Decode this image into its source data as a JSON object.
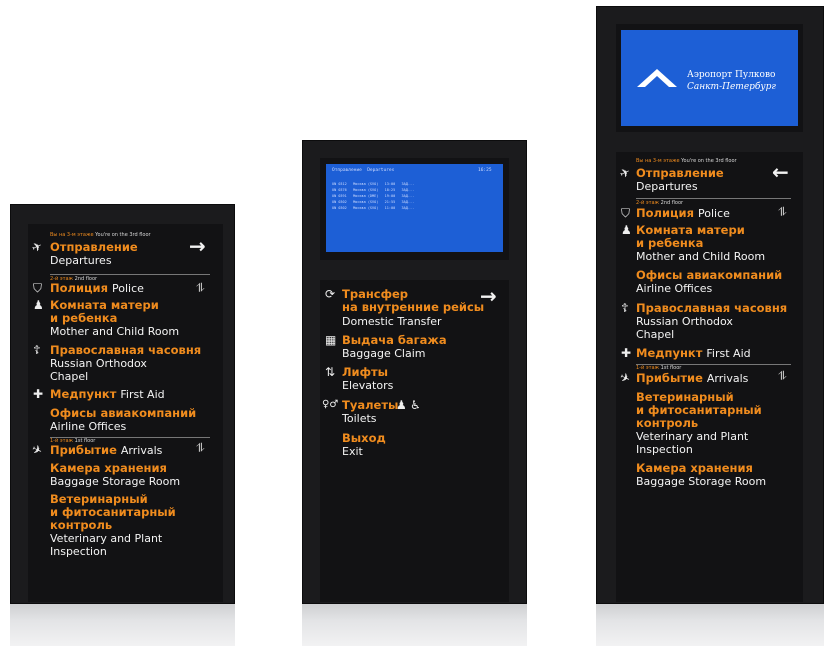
{
  "colors": {
    "totem": "#1b1b1d",
    "accent_orange": "#f08c1e",
    "screen_blue": "#1d5fd6",
    "text_white": "#f4f4f4"
  },
  "floor_labels": {
    "you_are_here_ru": "Вы на 3-м этаже",
    "you_are_here_en": "You're on the 3rd floor",
    "second_ru": "2-й этаж",
    "second_en": "2nd floor",
    "first_ru": "1-й этаж",
    "first_en": "1st floor"
  },
  "airport_logo": {
    "line1": "Аэропорт Пулково",
    "line2": "Санкт-Петербург",
    "icon": "pulkovo-logo-icon"
  },
  "fids": {
    "header": "Отправление  Departures",
    "time": "16:25",
    "rows": [
      "UN 0312   Москва (SVO)   13:00   ЗАД...",
      "UN 0376   Москва (SVO)   18:25   ЗАД...",
      "UN 0391   Москва (DME)   19:00   ЗАД...",
      "UN 0302   Москва (SVO)   21:55   ЗАД...",
      "UN 0302   Москва (SVO)   11:00   ЗАД..."
    ]
  },
  "labels": {
    "departures_ru": "Отправление",
    "departures_en": "Departures",
    "police_ru": "Полиция",
    "police_en": "Police",
    "mother_ru_1": "Комната матери",
    "mother_ru_2": "и ребенка",
    "mother_en": "Mother and Child Room",
    "chapel_ru": "Православная часовня",
    "chapel_en_1": "Russian Orthodox",
    "chapel_en_2": "Chapel",
    "firstaid_ru": "Медпункт",
    "firstaid_en": "First Aid",
    "airline_ru": "Офисы авиакомпаний",
    "airline_en": "Airline Offices",
    "arrivals_ru": "Прибытие",
    "arrivals_en": "Arrivals",
    "storage_ru": "Камера хранения",
    "storage_en": "Baggage Storage Room",
    "vet_ru_1": "Ветеринарный",
    "vet_ru_2": "и фитосанитарный",
    "vet_ru_3": "контроль",
    "vet_en_1": "Veterinary and Plant",
    "vet_en_2": "Inspection",
    "transfer_ru_1": "Трансфер",
    "transfer_ru_2": "на внутренние рейсы",
    "transfer_en": "Domestic Transfer",
    "baggage_ru": "Выдача багажа",
    "baggage_en": "Baggage Claim",
    "elevators_ru": "Лифты",
    "elevators_en": "Elevators",
    "toilets_ru": "Туалеты",
    "toilets_en": "Toilets",
    "exit_ru": "Выход",
    "exit_en": "Exit"
  },
  "icons": {
    "arrow_right": "→",
    "arrow_left": "←",
    "plane_takeoff": "✈",
    "plane_landing": "✈",
    "police": "⛉",
    "stroller": "♟",
    "chapel": "☦",
    "first_aid": "✚",
    "transfer": "⟳",
    "baggage": "▦",
    "elevator": "⇅",
    "toilets": "♀♂",
    "wheelchair": "♿",
    "escalator": "⥮"
  }
}
